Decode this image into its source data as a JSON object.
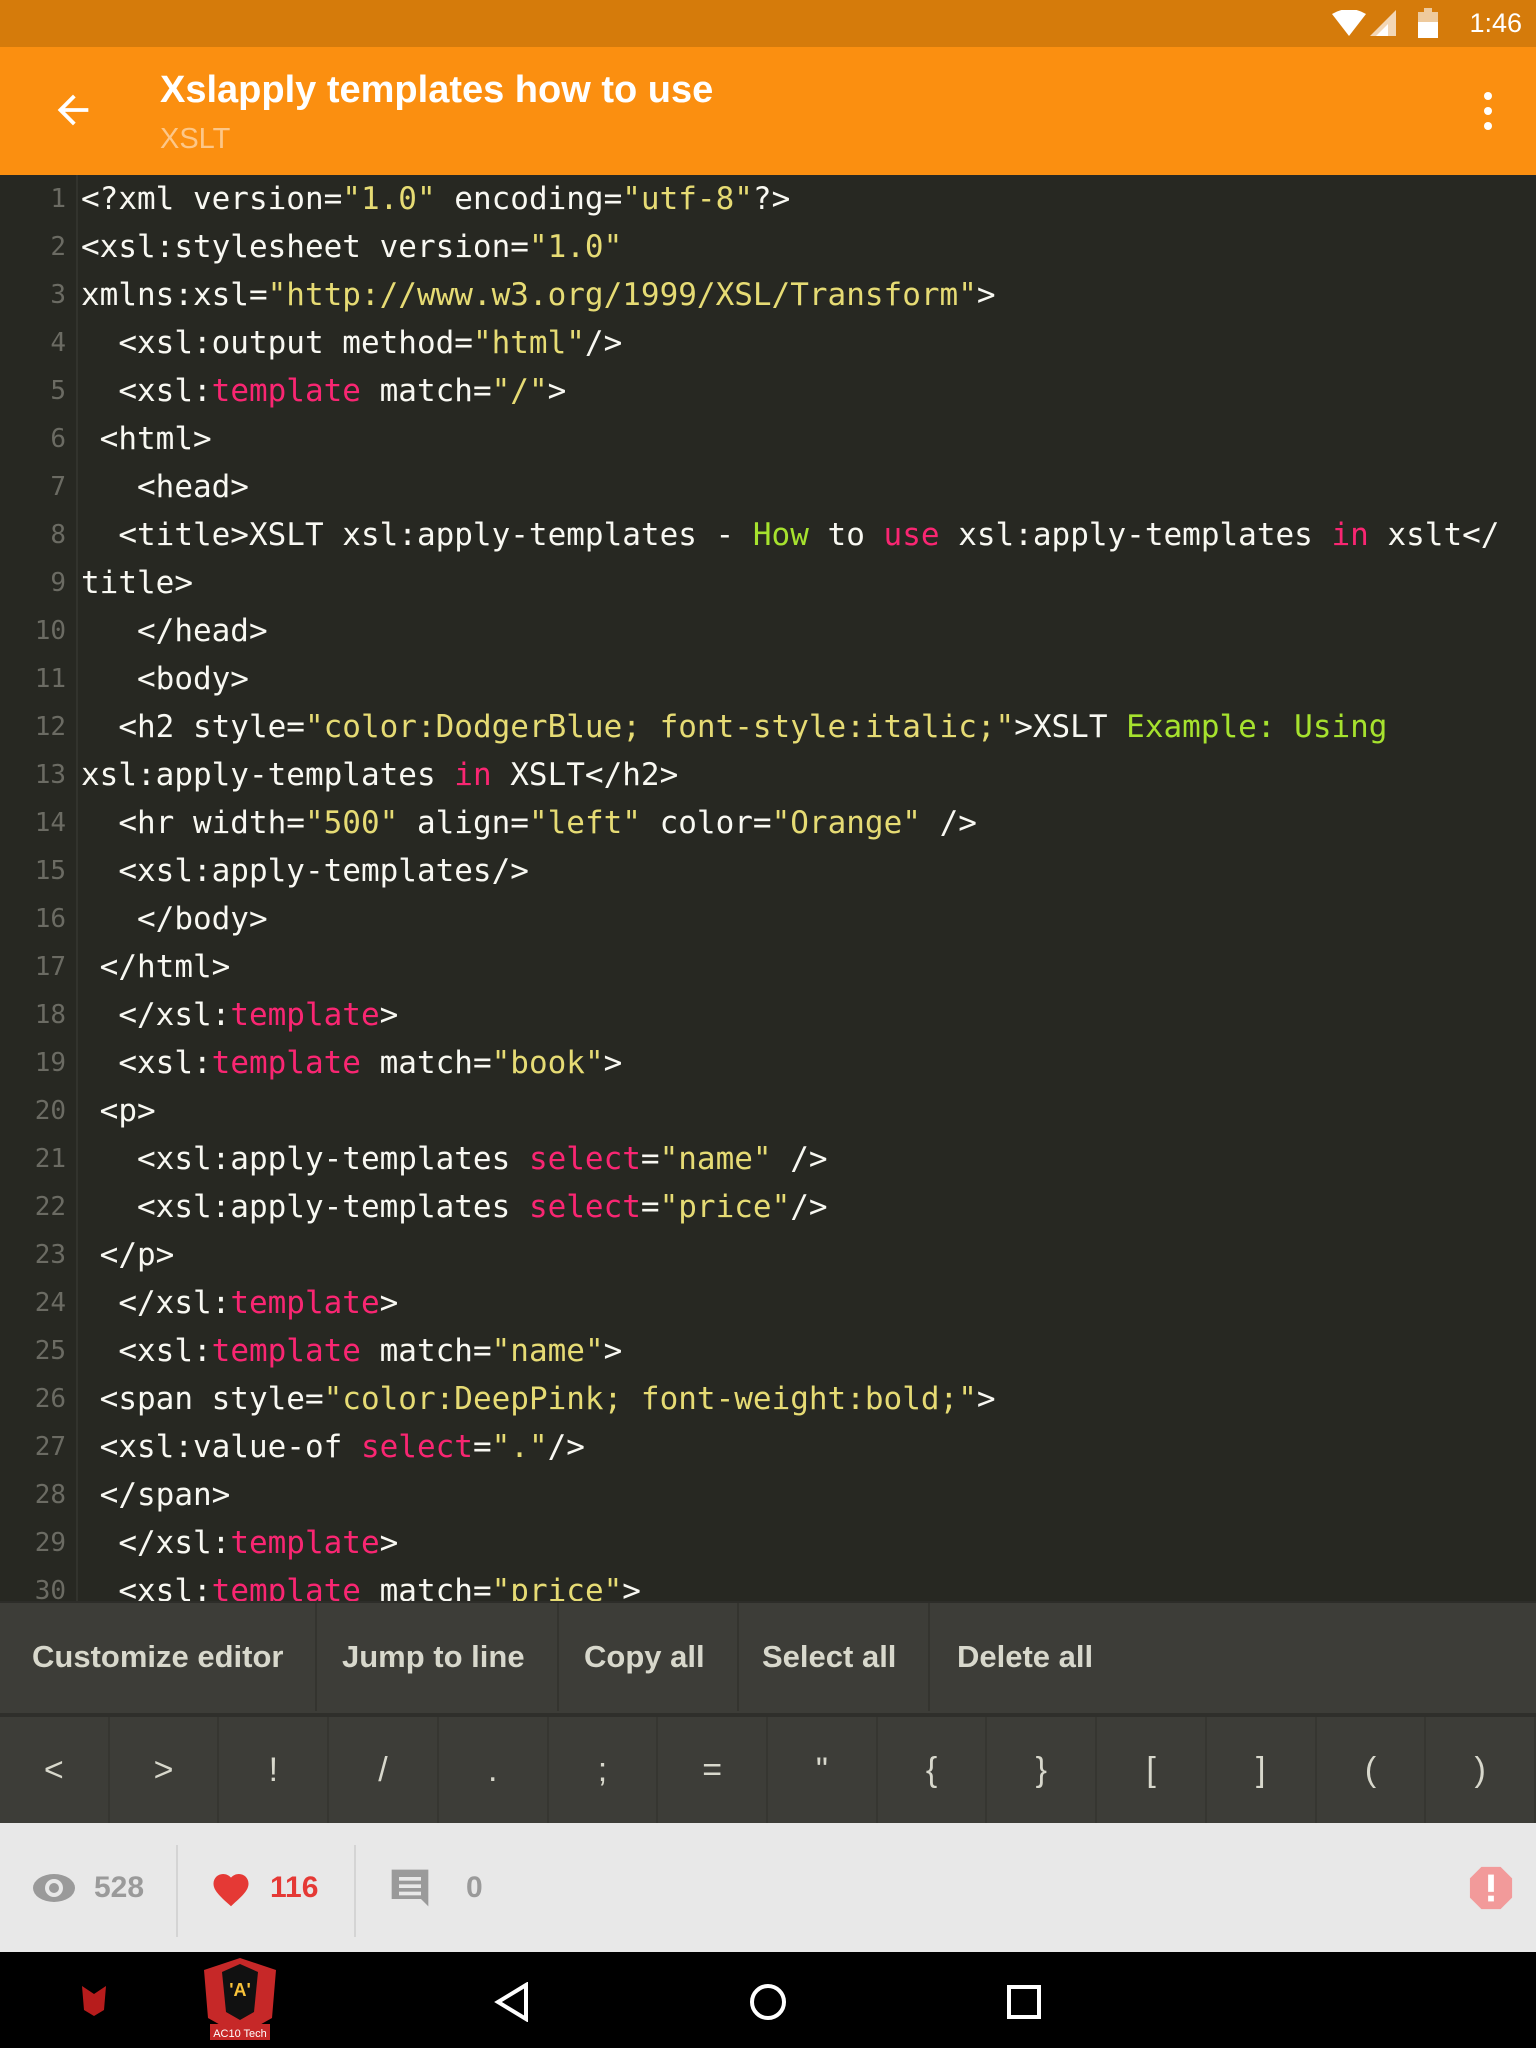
{
  "status_bar": {
    "time": "1:46",
    "icons": [
      "wifi-icon",
      "signal-icon",
      "battery-icon"
    ]
  },
  "app_bar": {
    "title": "Xslapply templates how to use",
    "subtitle": "XSLT",
    "back_icon": "arrow-left-icon",
    "menu_icon": "more-vert-icon"
  },
  "colors": {
    "status": "#d57b0b",
    "appbar": "#fb8f10",
    "editor_bg": "#272822",
    "string": "#e6db74",
    "keyword": "#f92672",
    "green": "#a6e22e",
    "like": "#e53935"
  },
  "code": {
    "lines": [
      [
        [
          "<?xml version=",
          ""
        ],
        [
          "\"1.0\"",
          "s"
        ],
        [
          " encoding=",
          ""
        ],
        [
          "\"utf-8\"",
          "s"
        ],
        [
          "?>",
          ""
        ]
      ],
      [
        [
          "<xsl:stylesheet version=",
          ""
        ],
        [
          "\"1.0\"",
          "s"
        ]
      ],
      [
        [
          "xmlns:xsl=",
          ""
        ],
        [
          "\"http://www.w3.org/1999/XSL/Transform\"",
          "s"
        ],
        [
          ">",
          ""
        ]
      ],
      [
        [
          "  <xsl:output method=",
          ""
        ],
        [
          "\"html\"",
          "s"
        ],
        [
          "/>",
          ""
        ]
      ],
      [
        [
          "  <xsl:",
          ""
        ],
        [
          "template",
          "k"
        ],
        [
          " match=",
          ""
        ],
        [
          "\"/\"",
          "s"
        ],
        [
          ">",
          ""
        ]
      ],
      [
        [
          " <html>",
          ""
        ]
      ],
      [
        [
          "   <head>",
          ""
        ]
      ],
      [
        [
          "  <title>XSLT xsl:apply-templates - ",
          ""
        ],
        [
          "How",
          "g"
        ],
        [
          " to ",
          ""
        ],
        [
          "use",
          "k"
        ],
        [
          " xsl:apply-templates ",
          ""
        ],
        [
          "in",
          "k"
        ],
        [
          " xslt</",
          ""
        ]
      ],
      [
        [
          "title>",
          ""
        ]
      ],
      [
        [
          "   </head>",
          ""
        ]
      ],
      [
        [
          "   <body>",
          ""
        ]
      ],
      [
        [
          "  <h2 style=",
          ""
        ],
        [
          "\"color:DodgerBlue; font-style:italic;\"",
          "s"
        ],
        [
          ">XSLT ",
          ""
        ],
        [
          "Example:",
          "g"
        ],
        [
          " ",
          ""
        ],
        [
          "Using",
          "g"
        ]
      ],
      [
        [
          "xsl:apply-templates ",
          ""
        ],
        [
          "in",
          "k"
        ],
        [
          " XSLT</h2>",
          ""
        ]
      ],
      [
        [
          "  <hr width=",
          ""
        ],
        [
          "\"500\"",
          "s"
        ],
        [
          " align=",
          ""
        ],
        [
          "\"left\"",
          "s"
        ],
        [
          " color=",
          ""
        ],
        [
          "\"Orange\"",
          "s"
        ],
        [
          " />",
          ""
        ]
      ],
      [
        [
          "  <xsl:apply-templates/>",
          ""
        ]
      ],
      [
        [
          "   </body>",
          ""
        ]
      ],
      [
        [
          " </html>",
          ""
        ]
      ],
      [
        [
          "  </xsl:",
          ""
        ],
        [
          "template",
          "k"
        ],
        [
          ">",
          ""
        ]
      ],
      [
        [
          "  <xsl:",
          ""
        ],
        [
          "template",
          "k"
        ],
        [
          " match=",
          ""
        ],
        [
          "\"book\"",
          "s"
        ],
        [
          ">",
          ""
        ]
      ],
      [
        [
          " <p>",
          ""
        ]
      ],
      [
        [
          "   <xsl:apply-templates ",
          ""
        ],
        [
          "select",
          "k"
        ],
        [
          "=",
          ""
        ],
        [
          "\"name\"",
          "s"
        ],
        [
          " />",
          ""
        ]
      ],
      [
        [
          "   <xsl:apply-templates ",
          ""
        ],
        [
          "select",
          "k"
        ],
        [
          "=",
          ""
        ],
        [
          "\"price\"",
          "s"
        ],
        [
          "/>",
          ""
        ]
      ],
      [
        [
          " </p>",
          ""
        ]
      ],
      [
        [
          "  </xsl:",
          ""
        ],
        [
          "template",
          "k"
        ],
        [
          ">",
          ""
        ]
      ],
      [
        [
          "  <xsl:",
          ""
        ],
        [
          "template",
          "k"
        ],
        [
          " match=",
          ""
        ],
        [
          "\"name\"",
          "s"
        ],
        [
          ">",
          ""
        ]
      ],
      [
        [
          " <span style=",
          ""
        ],
        [
          "\"color:DeepPink; font-weight:bold;\"",
          "s"
        ],
        [
          ">",
          ""
        ]
      ],
      [
        [
          " <xsl:value-of ",
          ""
        ],
        [
          "select",
          "k"
        ],
        [
          "=",
          ""
        ],
        [
          "\".\"",
          "s"
        ],
        [
          "/>",
          ""
        ]
      ],
      [
        [
          " </span>",
          ""
        ]
      ],
      [
        [
          "  </xsl:",
          ""
        ],
        [
          "template",
          "k"
        ],
        [
          ">",
          ""
        ]
      ],
      [
        [
          "  <xsl:",
          ""
        ],
        [
          "template",
          "k"
        ],
        [
          " match=",
          ""
        ],
        [
          "\"price\"",
          "s"
        ],
        [
          ">",
          ""
        ]
      ]
    ]
  },
  "toolbar": {
    "items": [
      "Customize editor",
      "Jump to line",
      "Copy all",
      "Select all",
      "Delete all"
    ]
  },
  "symbols": [
    "<",
    ">",
    "!",
    "/",
    ".",
    ";",
    "=",
    "\"",
    "{",
    "}",
    "[",
    "]",
    "(",
    ")"
  ],
  "stats": {
    "views": "528",
    "likes": "116",
    "comments": "0"
  }
}
